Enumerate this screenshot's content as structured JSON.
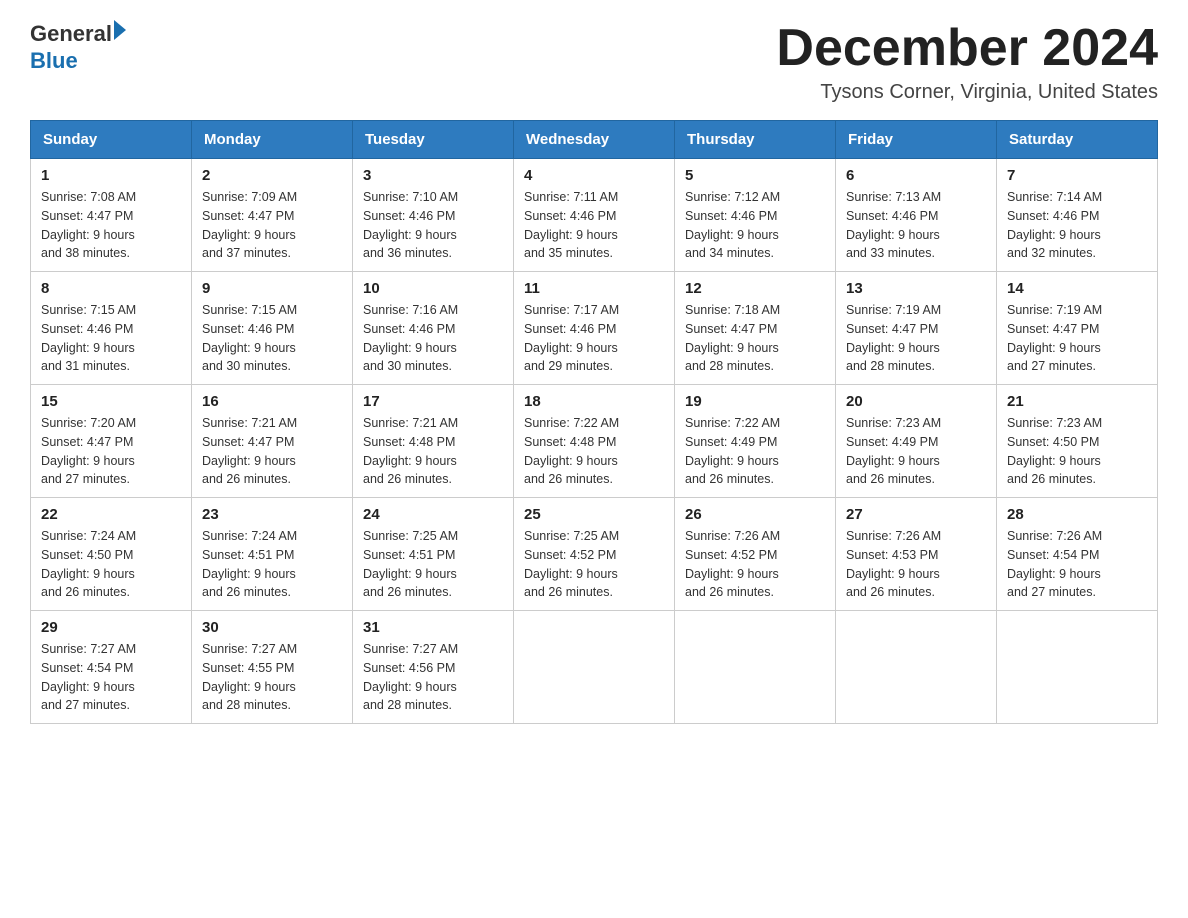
{
  "header": {
    "logo_general": "General",
    "logo_blue": "Blue",
    "month_title": "December 2024",
    "location": "Tysons Corner, Virginia, United States"
  },
  "weekdays": [
    "Sunday",
    "Monday",
    "Tuesday",
    "Wednesday",
    "Thursday",
    "Friday",
    "Saturday"
  ],
  "weeks": [
    [
      {
        "day": "1",
        "sunrise": "7:08 AM",
        "sunset": "4:47 PM",
        "daylight": "9 hours and 38 minutes."
      },
      {
        "day": "2",
        "sunrise": "7:09 AM",
        "sunset": "4:47 PM",
        "daylight": "9 hours and 37 minutes."
      },
      {
        "day": "3",
        "sunrise": "7:10 AM",
        "sunset": "4:46 PM",
        "daylight": "9 hours and 36 minutes."
      },
      {
        "day": "4",
        "sunrise": "7:11 AM",
        "sunset": "4:46 PM",
        "daylight": "9 hours and 35 minutes."
      },
      {
        "day": "5",
        "sunrise": "7:12 AM",
        "sunset": "4:46 PM",
        "daylight": "9 hours and 34 minutes."
      },
      {
        "day": "6",
        "sunrise": "7:13 AM",
        "sunset": "4:46 PM",
        "daylight": "9 hours and 33 minutes."
      },
      {
        "day": "7",
        "sunrise": "7:14 AM",
        "sunset": "4:46 PM",
        "daylight": "9 hours and 32 minutes."
      }
    ],
    [
      {
        "day": "8",
        "sunrise": "7:15 AM",
        "sunset": "4:46 PM",
        "daylight": "9 hours and 31 minutes."
      },
      {
        "day": "9",
        "sunrise": "7:15 AM",
        "sunset": "4:46 PM",
        "daylight": "9 hours and 30 minutes."
      },
      {
        "day": "10",
        "sunrise": "7:16 AM",
        "sunset": "4:46 PM",
        "daylight": "9 hours and 30 minutes."
      },
      {
        "day": "11",
        "sunrise": "7:17 AM",
        "sunset": "4:46 PM",
        "daylight": "9 hours and 29 minutes."
      },
      {
        "day": "12",
        "sunrise": "7:18 AM",
        "sunset": "4:47 PM",
        "daylight": "9 hours and 28 minutes."
      },
      {
        "day": "13",
        "sunrise": "7:19 AM",
        "sunset": "4:47 PM",
        "daylight": "9 hours and 28 minutes."
      },
      {
        "day": "14",
        "sunrise": "7:19 AM",
        "sunset": "4:47 PM",
        "daylight": "9 hours and 27 minutes."
      }
    ],
    [
      {
        "day": "15",
        "sunrise": "7:20 AM",
        "sunset": "4:47 PM",
        "daylight": "9 hours and 27 minutes."
      },
      {
        "day": "16",
        "sunrise": "7:21 AM",
        "sunset": "4:47 PM",
        "daylight": "9 hours and 26 minutes."
      },
      {
        "day": "17",
        "sunrise": "7:21 AM",
        "sunset": "4:48 PM",
        "daylight": "9 hours and 26 minutes."
      },
      {
        "day": "18",
        "sunrise": "7:22 AM",
        "sunset": "4:48 PM",
        "daylight": "9 hours and 26 minutes."
      },
      {
        "day": "19",
        "sunrise": "7:22 AM",
        "sunset": "4:49 PM",
        "daylight": "9 hours and 26 minutes."
      },
      {
        "day": "20",
        "sunrise": "7:23 AM",
        "sunset": "4:49 PM",
        "daylight": "9 hours and 26 minutes."
      },
      {
        "day": "21",
        "sunrise": "7:23 AM",
        "sunset": "4:50 PM",
        "daylight": "9 hours and 26 minutes."
      }
    ],
    [
      {
        "day": "22",
        "sunrise": "7:24 AM",
        "sunset": "4:50 PM",
        "daylight": "9 hours and 26 minutes."
      },
      {
        "day": "23",
        "sunrise": "7:24 AM",
        "sunset": "4:51 PM",
        "daylight": "9 hours and 26 minutes."
      },
      {
        "day": "24",
        "sunrise": "7:25 AM",
        "sunset": "4:51 PM",
        "daylight": "9 hours and 26 minutes."
      },
      {
        "day": "25",
        "sunrise": "7:25 AM",
        "sunset": "4:52 PM",
        "daylight": "9 hours and 26 minutes."
      },
      {
        "day": "26",
        "sunrise": "7:26 AM",
        "sunset": "4:52 PM",
        "daylight": "9 hours and 26 minutes."
      },
      {
        "day": "27",
        "sunrise": "7:26 AM",
        "sunset": "4:53 PM",
        "daylight": "9 hours and 26 minutes."
      },
      {
        "day": "28",
        "sunrise": "7:26 AM",
        "sunset": "4:54 PM",
        "daylight": "9 hours and 27 minutes."
      }
    ],
    [
      {
        "day": "29",
        "sunrise": "7:27 AM",
        "sunset": "4:54 PM",
        "daylight": "9 hours and 27 minutes."
      },
      {
        "day": "30",
        "sunrise": "7:27 AM",
        "sunset": "4:55 PM",
        "daylight": "9 hours and 28 minutes."
      },
      {
        "day": "31",
        "sunrise": "7:27 AM",
        "sunset": "4:56 PM",
        "daylight": "9 hours and 28 minutes."
      },
      null,
      null,
      null,
      null
    ]
  ],
  "labels": {
    "sunrise": "Sunrise:",
    "sunset": "Sunset:",
    "daylight": "Daylight:"
  }
}
